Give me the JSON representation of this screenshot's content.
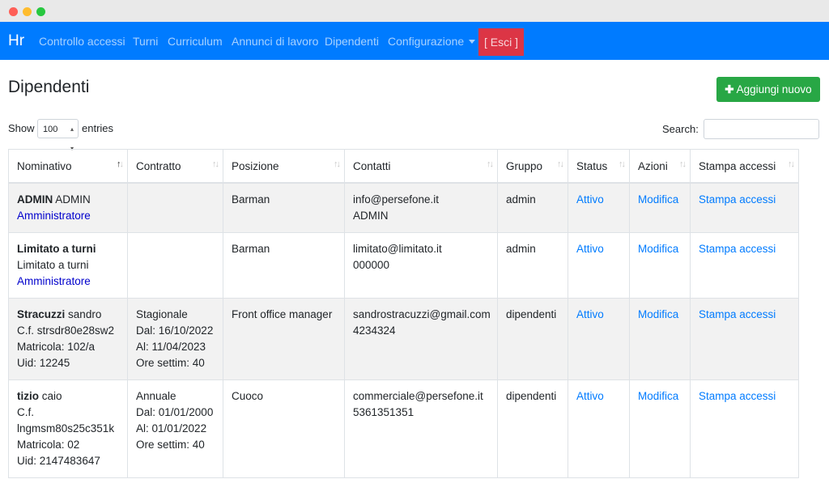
{
  "nav": {
    "brand": "Hr",
    "links": [
      "Controllo accessi",
      "Turni",
      "Curriculum",
      "Annunci di lavoro",
      "Dipendenti",
      "Configurazione"
    ],
    "logout": "[ Esci ]"
  },
  "page": {
    "title": "Dipendenti",
    "add_button": "Aggiungi nuovo"
  },
  "controls": {
    "show_label": "Show",
    "page_length": "100",
    "entries_label": "entries",
    "search_label": "Search:",
    "search_value": ""
  },
  "table": {
    "headers": [
      "Nominativo",
      "Contratto",
      "Posizione",
      "Contatti",
      "Gruppo",
      "Status",
      "Azioni",
      "Stampa accessi"
    ],
    "rows": [
      {
        "name_bold": "ADMIN",
        "name_rest": "ADMIN",
        "details": [],
        "role": "Amministratore",
        "contract": [],
        "position": "Barman",
        "contacts": [
          "info@persefone.it",
          "ADMIN"
        ],
        "group": "admin",
        "status": "Attivo",
        "action": "Modifica",
        "print": "Stampa accessi"
      },
      {
        "name_bold": "Limitato a turni",
        "name_rest": "",
        "details": [
          "Limitato a turni"
        ],
        "role": "Amministratore",
        "contract": [],
        "position": "Barman",
        "contacts": [
          "limitato@limitato.it",
          "000000"
        ],
        "group": "admin",
        "status": "Attivo",
        "action": "Modifica",
        "print": "Stampa accessi"
      },
      {
        "name_bold": "Stracuzzi",
        "name_rest": "sandro",
        "details": [
          "C.f. strsdr80e28sw2",
          "Matricola: 102/a",
          "Uid: 12245"
        ],
        "role": "",
        "contract": [
          "Stagionale",
          "Dal: 16/10/2022",
          "Al: 11/04/2023",
          "Ore settim: 40"
        ],
        "position": "Front office manager",
        "contacts": [
          "sandrostracuzzi@gmail.com",
          "4234324"
        ],
        "group": "dipendenti",
        "status": "Attivo",
        "action": "Modifica",
        "print": "Stampa accessi"
      },
      {
        "name_bold": "tizio",
        "name_rest": "caio",
        "details": [
          "C.f.",
          "lngmsm80s25c351k",
          "Matricola: 02",
          "Uid: 2147483647"
        ],
        "role": "",
        "contract": [
          "Annuale",
          "Dal: 01/01/2000",
          "Al: 01/01/2022",
          "Ore settim: 40"
        ],
        "position": "Cuoco",
        "contacts": [
          "commerciale@persefone.it",
          "5361351351"
        ],
        "group": "dipendenti",
        "status": "Attivo",
        "action": "Modifica",
        "print": "Stampa accessi"
      }
    ]
  },
  "colors": {
    "navbar": "#007bff",
    "logout": "#dc3545",
    "add_button": "#28a745",
    "link": "#007bff"
  },
  "icons": {
    "add": "plus-icon",
    "sort": "sort-arrows-icon",
    "dropdown": "caret-down-icon"
  }
}
